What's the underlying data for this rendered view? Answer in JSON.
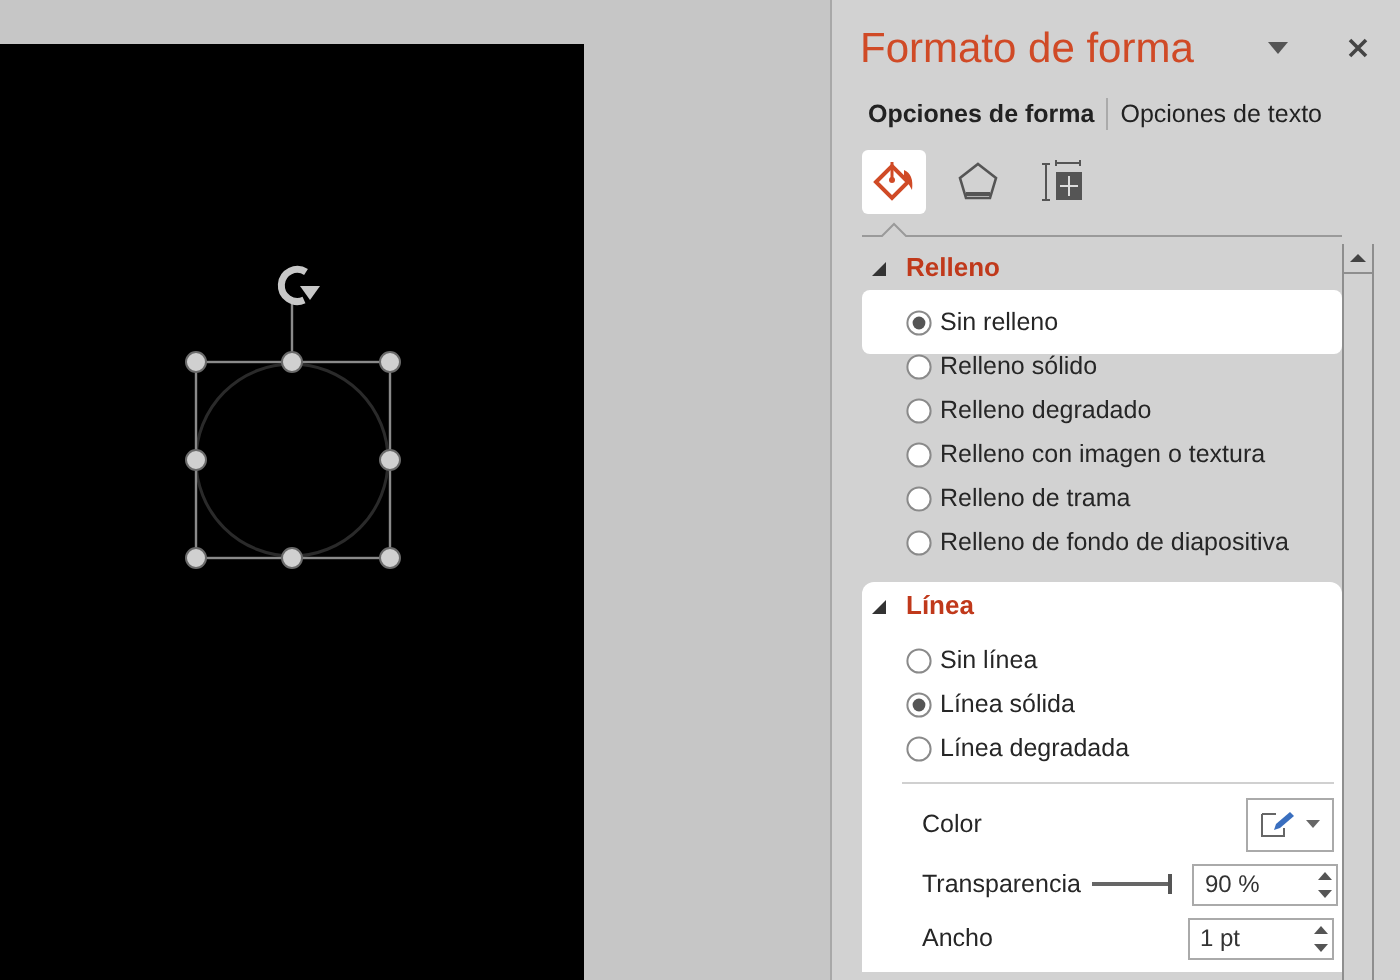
{
  "slide": {
    "selected": true
  },
  "pane": {
    "title": "Formato de forma",
    "tabs": [
      {
        "label": "Opciones de forma",
        "selected": true
      },
      {
        "label": "Opciones de texto",
        "selected": false
      }
    ],
    "icon_tabs": [
      {
        "kind": "fill",
        "selected": true
      },
      {
        "kind": "effects",
        "selected": false
      },
      {
        "kind": "size",
        "selected": false
      }
    ],
    "sections": [
      {
        "title": "Relleno",
        "expanded": true,
        "highlighted": false,
        "options": [
          {
            "label": "Sin relleno",
            "selected": true,
            "highlighted": true
          },
          {
            "label": "Relleno sólido",
            "selected": false,
            "highlighted": false
          },
          {
            "label": "Relleno degradado",
            "selected": false,
            "highlighted": false
          },
          {
            "label": "Relleno con imagen o textura",
            "selected": false,
            "highlighted": false
          },
          {
            "label": "Relleno de trama",
            "selected": false,
            "highlighted": false
          },
          {
            "label": "Relleno de fondo de diapositiva",
            "selected": false,
            "highlighted": false
          }
        ]
      },
      {
        "title": "Línea",
        "expanded": true,
        "highlighted": true,
        "options": [
          {
            "label": "Sin línea",
            "selected": false,
            "highlighted": false
          },
          {
            "label": "Línea sólida",
            "selected": true,
            "highlighted": false
          },
          {
            "label": "Línea degradada",
            "selected": false,
            "highlighted": false
          }
        ],
        "settings": [
          {
            "kind": "color",
            "label": "Color"
          },
          {
            "kind": "slider",
            "label": "Transparencia",
            "value": "90 %"
          },
          {
            "kind": "spin",
            "label": "Ancho",
            "value": "1 pt"
          }
        ]
      }
    ]
  }
}
